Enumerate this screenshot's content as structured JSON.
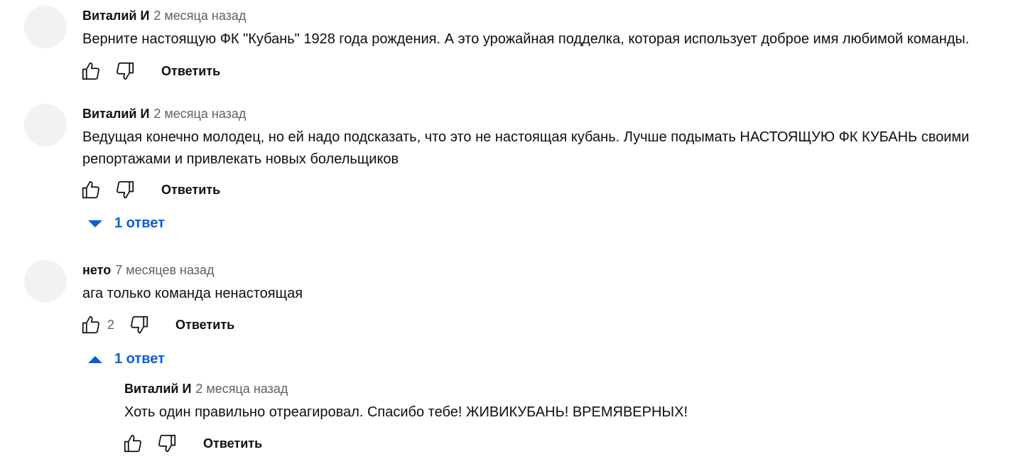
{
  "comments": [
    {
      "author": "Виталий И",
      "time": "2 месяца назад",
      "text": "Верните настоящую ФК \"Кубань\" 1928 года рождения. А это урожайная подделка, которая использует доброе имя любимой команды.",
      "reply_label": "Ответить"
    },
    {
      "author": "Виталий И",
      "time": "2 месяца назад",
      "text_line1": "Ведущая конечно молодец, но ей надо подсказать, что это не настоящая кубань. Лучше подымать НАСТОЯЩУЮ ФК КУБАНЬ своими",
      "text_line2": "репортажами и привлекать новых болельщиков",
      "reply_label": "Ответить",
      "replies_toggle": "1 ответ"
    },
    {
      "author": "нето",
      "time": "7 месяцев назад",
      "text": "ага только команда ненастоящая",
      "likes": "2",
      "reply_label": "Ответить",
      "replies_toggle": "1 ответ"
    }
  ],
  "reply": {
    "author": "Виталий И",
    "time": "2 месяца назад",
    "text": "Хоть один правильно отреагировал. Спасибо тебе! ЖИВИКУБАНЬ! ВРЕМЯВЕРНЫХ!",
    "reply_label": "Ответить"
  },
  "colors": {
    "link": "#065fd4",
    "secondary": "#606060",
    "avatar": "#f2f2f2"
  }
}
